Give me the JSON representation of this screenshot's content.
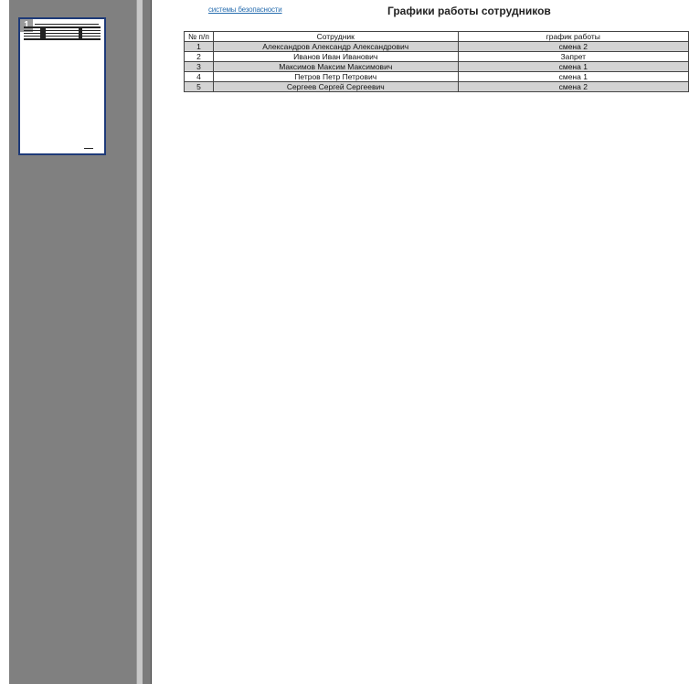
{
  "thumbnail": {
    "page_number": "1"
  },
  "report": {
    "logo_text": "системы безопасности",
    "title": "Графики работы сотрудников",
    "columns": [
      "№ п/п",
      "Сотрудник",
      "график работы"
    ],
    "rows": [
      [
        "1",
        "Александров Александр Александрович",
        "смена 2"
      ],
      [
        "2",
        "Иванов Иван Иванович",
        "Запрет"
      ],
      [
        "3",
        "Максимов Максим Максимович",
        "смена 1"
      ],
      [
        "4",
        "Петров Петр Петрович",
        "смена 1"
      ],
      [
        "5",
        "Сергеев Сергей Сергеевич",
        "смена 2"
      ]
    ]
  }
}
